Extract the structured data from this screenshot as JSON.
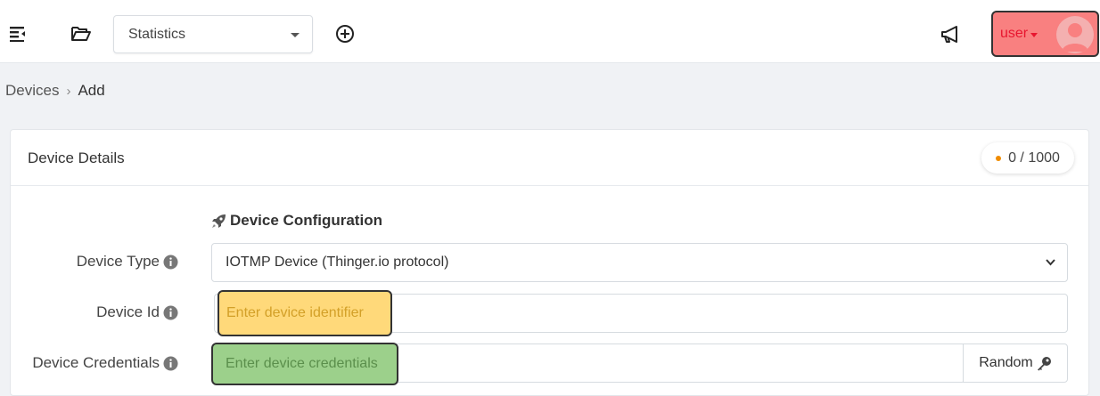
{
  "topbar": {
    "project_select": "Statistics",
    "user_label": "user"
  },
  "breadcrumb": {
    "items": [
      "Devices",
      "Add"
    ]
  },
  "card": {
    "title": "Device Details",
    "quota": "0 / 1000"
  },
  "form": {
    "section_title": "Device Configuration",
    "device_type_label": "Device Type",
    "device_type_value": "IOTMP Device (Thinger.io protocol)",
    "device_id_label": "Device Id",
    "device_id_placeholder": "Enter device identifier",
    "credentials_label": "Device Credentials",
    "credentials_placeholder": "Enter device credentials",
    "random_button": "Random"
  },
  "icons": {
    "menu": "menu-collapse-icon",
    "folder": "folder-open-icon",
    "add": "plus-circle-icon",
    "announcements": "megaphone-icon",
    "avatar": "user-avatar-icon",
    "rocket": "rocket-icon",
    "info": "info-icon",
    "key": "key-icon"
  },
  "colors": {
    "user_highlight": "#f98080",
    "id_highlight": "#ffd97a",
    "credentials_highlight": "#9cd08b",
    "quota_dot": "#f08c00"
  }
}
